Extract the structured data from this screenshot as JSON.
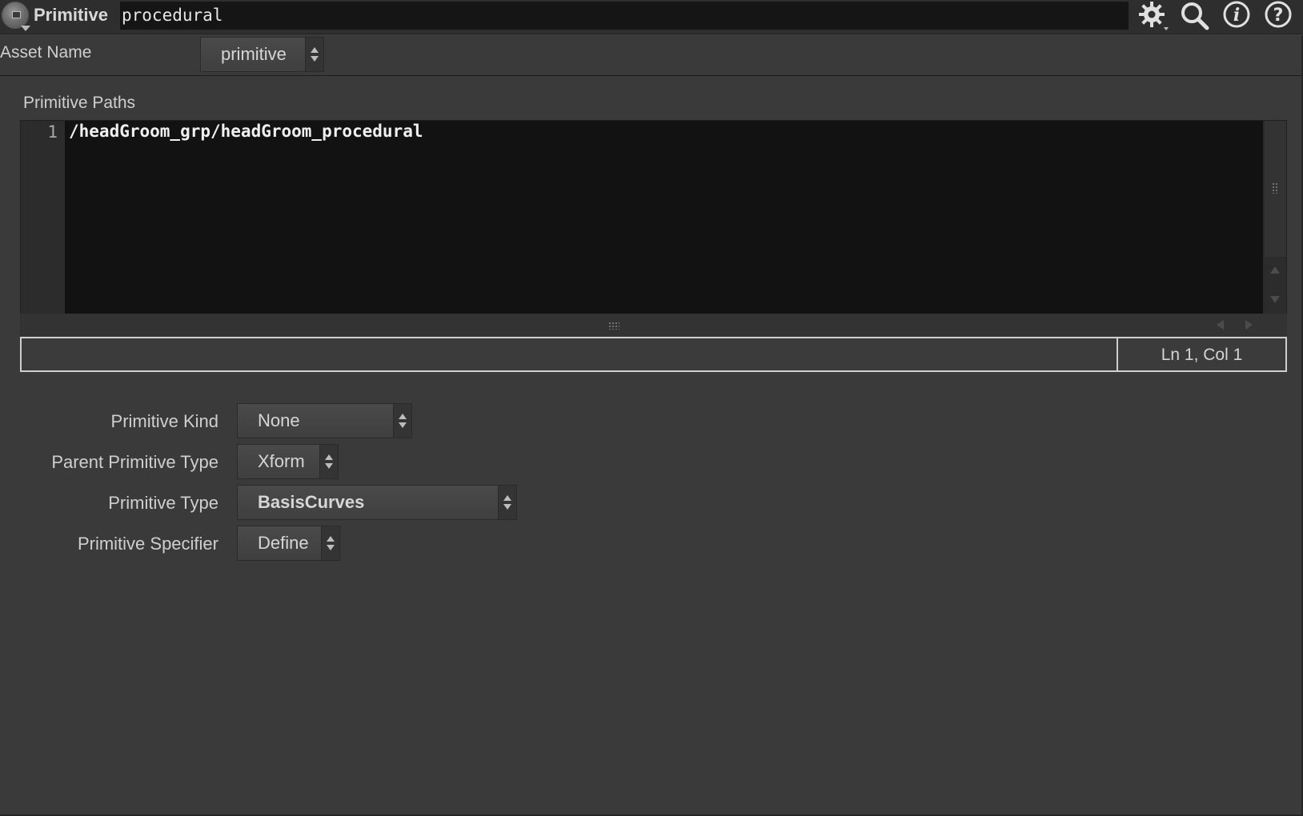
{
  "header": {
    "node_type": "Primitive",
    "node_name": "procedural",
    "icons": [
      "gear-icon",
      "search-icon",
      "info-icon",
      "help-icon"
    ]
  },
  "asset": {
    "label": "Asset Name",
    "value": "primitive"
  },
  "paths": {
    "label": "Primitive Paths",
    "line_number": "1",
    "code": "/headGroom_grp/headGroom_procedural",
    "cursor_position": "Ln 1, Col 1"
  },
  "params": {
    "kind": {
      "label": "Primitive Kind",
      "value": "None"
    },
    "parent_type": {
      "label": "Parent Primitive Type",
      "value": "Xform"
    },
    "prim_type": {
      "label": "Primitive Type",
      "value": "BasisCurves"
    },
    "specifier": {
      "label": "Primitive Specifier",
      "value": "Define"
    }
  },
  "colors": {
    "background": "#3a3a3a",
    "editor_background": "#121212",
    "header_background": "#2e2e2e"
  }
}
